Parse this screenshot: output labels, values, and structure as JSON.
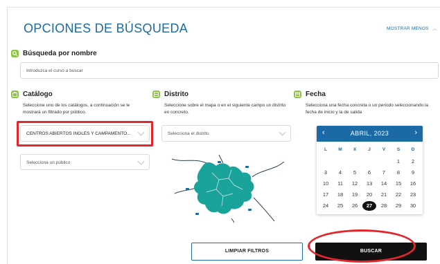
{
  "header": {
    "title": "OPCIONES DE BÚSQUEDA",
    "toggle_label": "MOSTRAR MENOS"
  },
  "name_search": {
    "title": "Búsqueda por nombre",
    "placeholder": "Introduzca el curso a buscar"
  },
  "catalog": {
    "title": "Catálogo",
    "description": "Seleccione uno de los catálogos, a continuación se le mostrará un filtrado por público.",
    "selected": "CENTROS ABIERTOS INGLES Y CAMPAMENTO...",
    "audience_placeholder": "Selecciona un público"
  },
  "district": {
    "title": "Distrito",
    "description": "Seleccione sobre el mapa o en el siguiente campo un distrito en concreto.",
    "placeholder": "Selecciona el distrito"
  },
  "date": {
    "title": "Fecha",
    "description": "Selecciona una fecha concreta o un periodo seleccionando la fecha de inicio y la de salida",
    "calendar": {
      "month_label": "ABRIL, 2023",
      "weekdays": [
        "L",
        "M",
        "X",
        "J",
        "V",
        "S",
        "D"
      ],
      "weeks": [
        [
          "",
          "",
          "",
          "",
          "",
          "1",
          "2"
        ],
        [
          "3",
          "4",
          "5",
          "6",
          "7",
          "8",
          "9"
        ],
        [
          "10",
          "11",
          "12",
          "13",
          "14",
          "15",
          "16"
        ],
        [
          "17",
          "18",
          "19",
          "20",
          "21",
          "22",
          "23"
        ],
        [
          "24",
          "25",
          "26",
          "27",
          "28",
          "29",
          "30"
        ]
      ],
      "selected_day": "27"
    }
  },
  "actions": {
    "clear_label": "LIMPIAR FILTROS",
    "search_label": "BUSCAR"
  },
  "colors": {
    "accent": "#1b6aa5",
    "icon_green": "#8cc63f",
    "map_fill": "#1aa39a",
    "highlight_red": "#e3262c",
    "primary_button": "#111111"
  },
  "icons": [
    "search-icon",
    "catalog-icon",
    "district-icon",
    "calendar-icon",
    "chevron-up-icon",
    "chevron-down-icon",
    "arrow-left-icon",
    "arrow-right-icon"
  ]
}
